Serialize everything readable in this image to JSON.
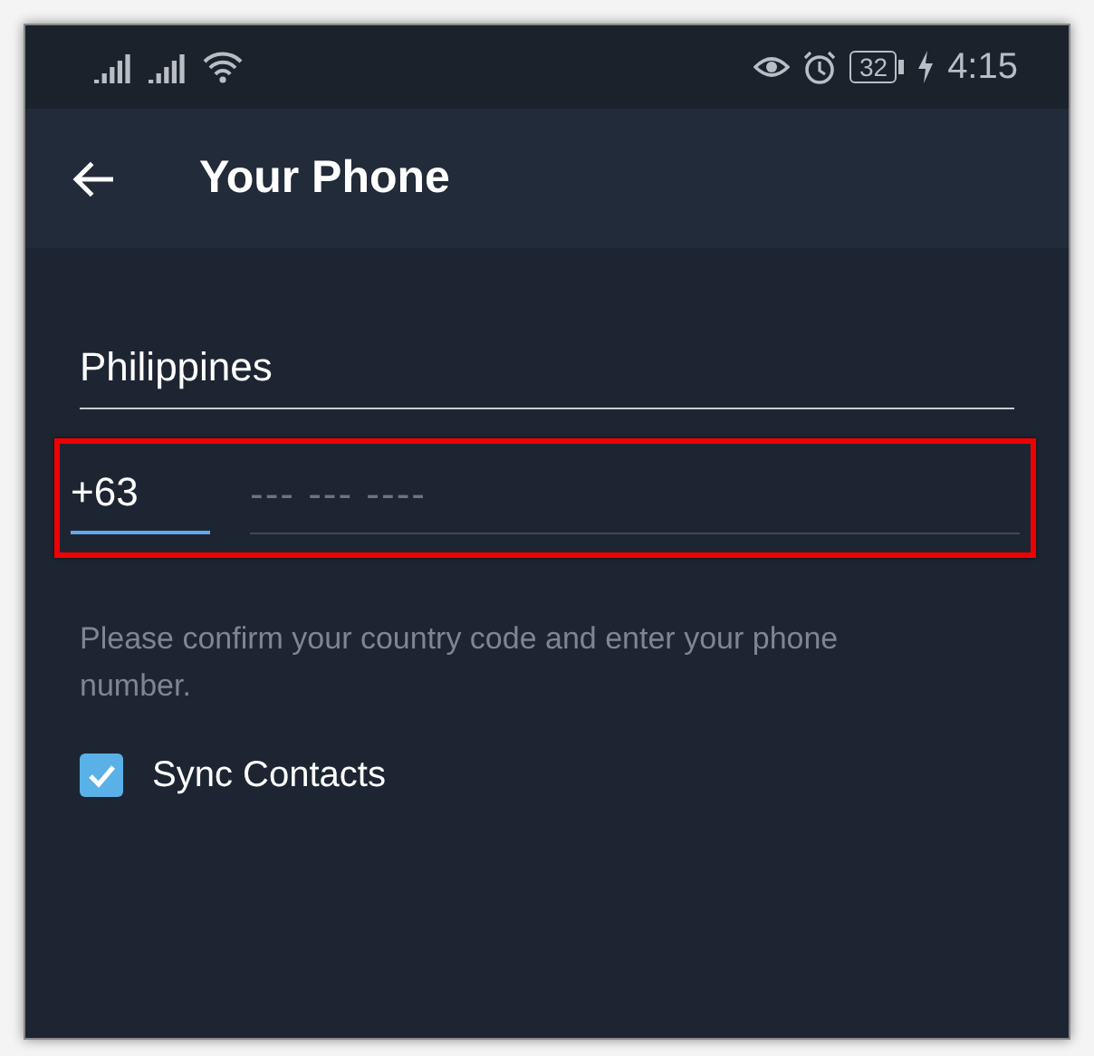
{
  "status_bar": {
    "battery": "32",
    "time": "4:15"
  },
  "app_bar": {
    "title": "Your Phone"
  },
  "country": {
    "value": "Philippines"
  },
  "phone": {
    "code": "+63",
    "code_focused": true,
    "placeholder": "--- --- ----",
    "highlighted": true
  },
  "help_text": "Please confirm your country code and enter your phone number.",
  "sync_contacts": {
    "label": "Sync Contacts",
    "checked": true
  }
}
